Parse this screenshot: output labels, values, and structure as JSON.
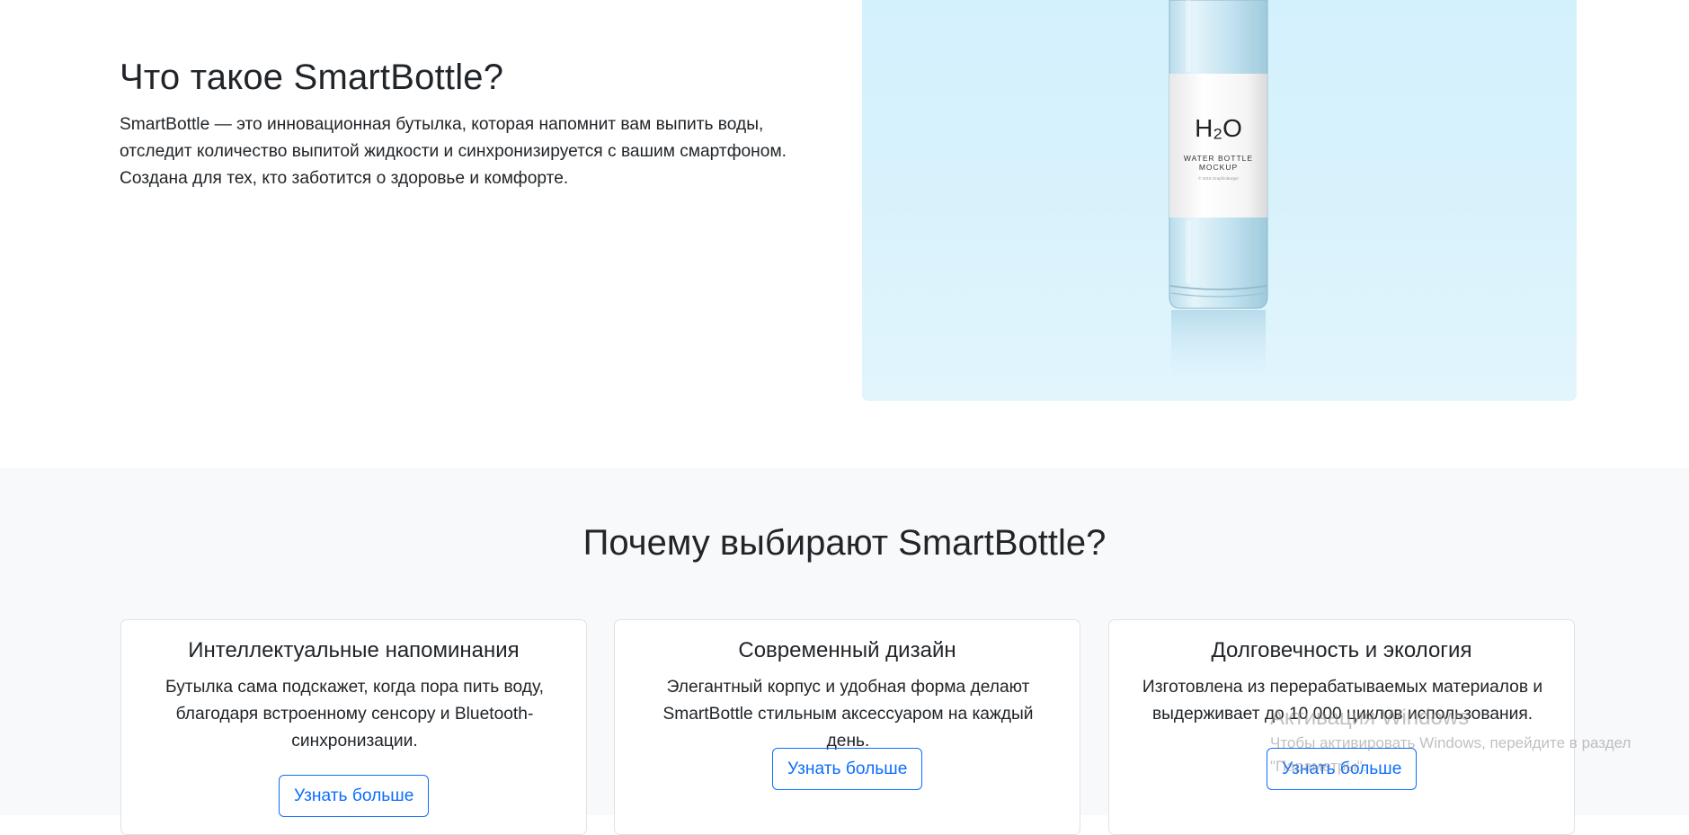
{
  "about": {
    "title": "Что такое SmartBottle?",
    "text": "SmartBottle — это инновационная бутылка, которая напомнит вам выпить воды, отследит количество выпитой жидкости и синхронизируется с вашим смартфоном. Создана для тех, кто заботится о здоровье и комфорте.",
    "image": {
      "label_main": "H₂O",
      "label_line1": "WATER BOTTLE",
      "label_line2": "MOCKUP",
      "label_small": "© 2016 GraphicBurger",
      "background_color": "#d6f2fc"
    }
  },
  "features": {
    "title": "Почему выбирают SmartBottle?",
    "cards": [
      {
        "title": "Интеллектуальные напоминания",
        "text": "Бутылка сама подскажет, когда пора пить воду, благодаря встроенному сенсору и Bluetooth-синхронизации.",
        "button": "Узнать больше"
      },
      {
        "title": "Современный дизайн",
        "text": "Элегантный корпус и удобная форма делают SmartBottle стильным аксессуаром на каждый день.",
        "button": "Узнать больше"
      },
      {
        "title": "Долговечность и экология",
        "text": "Изготовлена из перерабатываемых материалов и выдерживает до 10 000 циклов использования.",
        "button": "Узнать больше"
      }
    ]
  },
  "watermark": {
    "title": "Активация Windows",
    "text": "Чтобы активировать Windows, перейдите в раздел \"Параметры\"."
  },
  "colors": {
    "accent": "#0d6efd",
    "section_bg": "#f8f9fa",
    "text": "#212529"
  }
}
